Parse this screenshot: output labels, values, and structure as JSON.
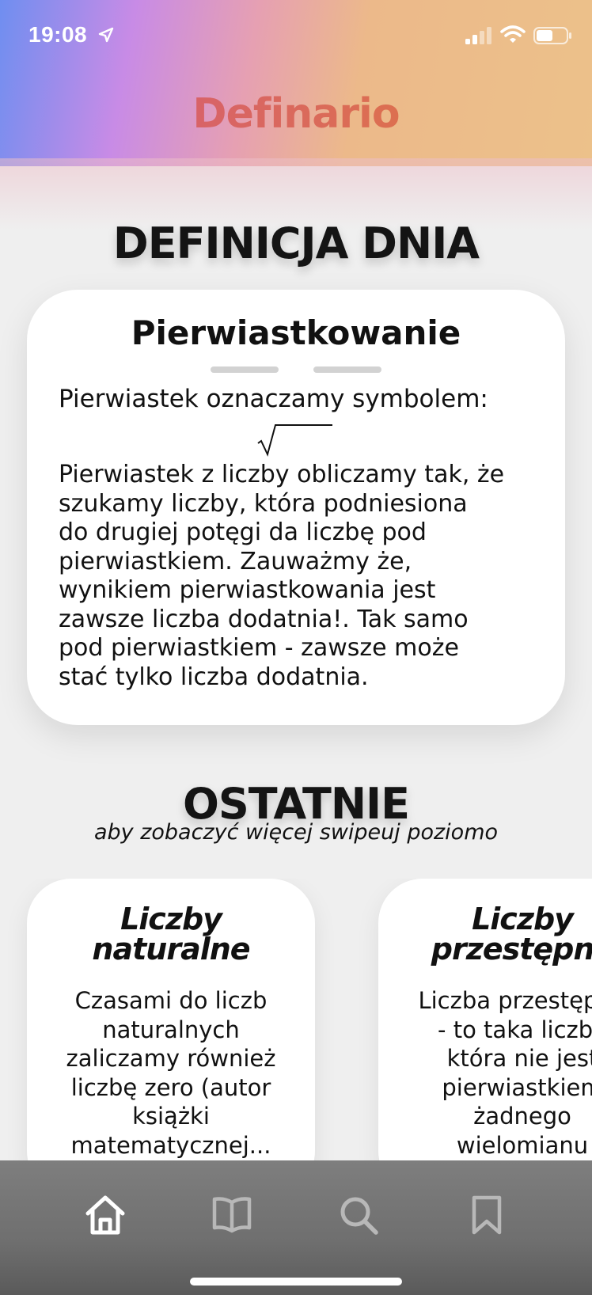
{
  "status_bar": {
    "time": "19:08",
    "icons": [
      "location-arrow-icon",
      "cellular-signal-icon",
      "wifi-icon",
      "battery-icon"
    ]
  },
  "app": {
    "title": "Definario",
    "title_gradient": [
      "#d4577e",
      "#e07b3a"
    ]
  },
  "definition_of_day": {
    "section_title": "DEFINICJA DNIA",
    "term": "Pierwiastkowanie",
    "intro": "Pierwiastek oznaczamy symbolem:",
    "symbol": "√",
    "body_lines": [
      "Pierwiastek z liczby obliczamy tak, że",
      "szukamy liczby, która podniesiona",
      "do drugiej potęgi da liczbę pod",
      "pierwiastkiem. Zauważmy że,",
      "wynikiem pierwiastkowania jest",
      "zawsze liczba dodatnia!. Tak samo",
      "pod pierwiastkiem - zawsze może",
      "stać tylko liczba dodatnia."
    ]
  },
  "recent": {
    "section_title": "OSTATNIE",
    "hint": "aby zobaczyć więcej swipeuj poziomo",
    "cards": [
      {
        "title_lines": [
          "Liczby",
          "naturalne"
        ],
        "text_lines": [
          "Czasami do liczb",
          "naturalnych",
          "zaliczamy również",
          "liczbę zero (autor",
          "książki",
          "matematycznej..."
        ]
      },
      {
        "title_lines": [
          "Liczby",
          "przestępne"
        ],
        "text_lines": [
          "Liczba przestępna",
          "- to taka liczba",
          "która nie jest",
          "pierwiastkiem",
          "żadnego",
          "wielomianu"
        ]
      }
    ]
  },
  "tab_bar": {
    "tabs": [
      "home-icon",
      "book-icon",
      "search-icon",
      "bookmark-icon"
    ],
    "active": "home-icon",
    "background": "#767676"
  }
}
